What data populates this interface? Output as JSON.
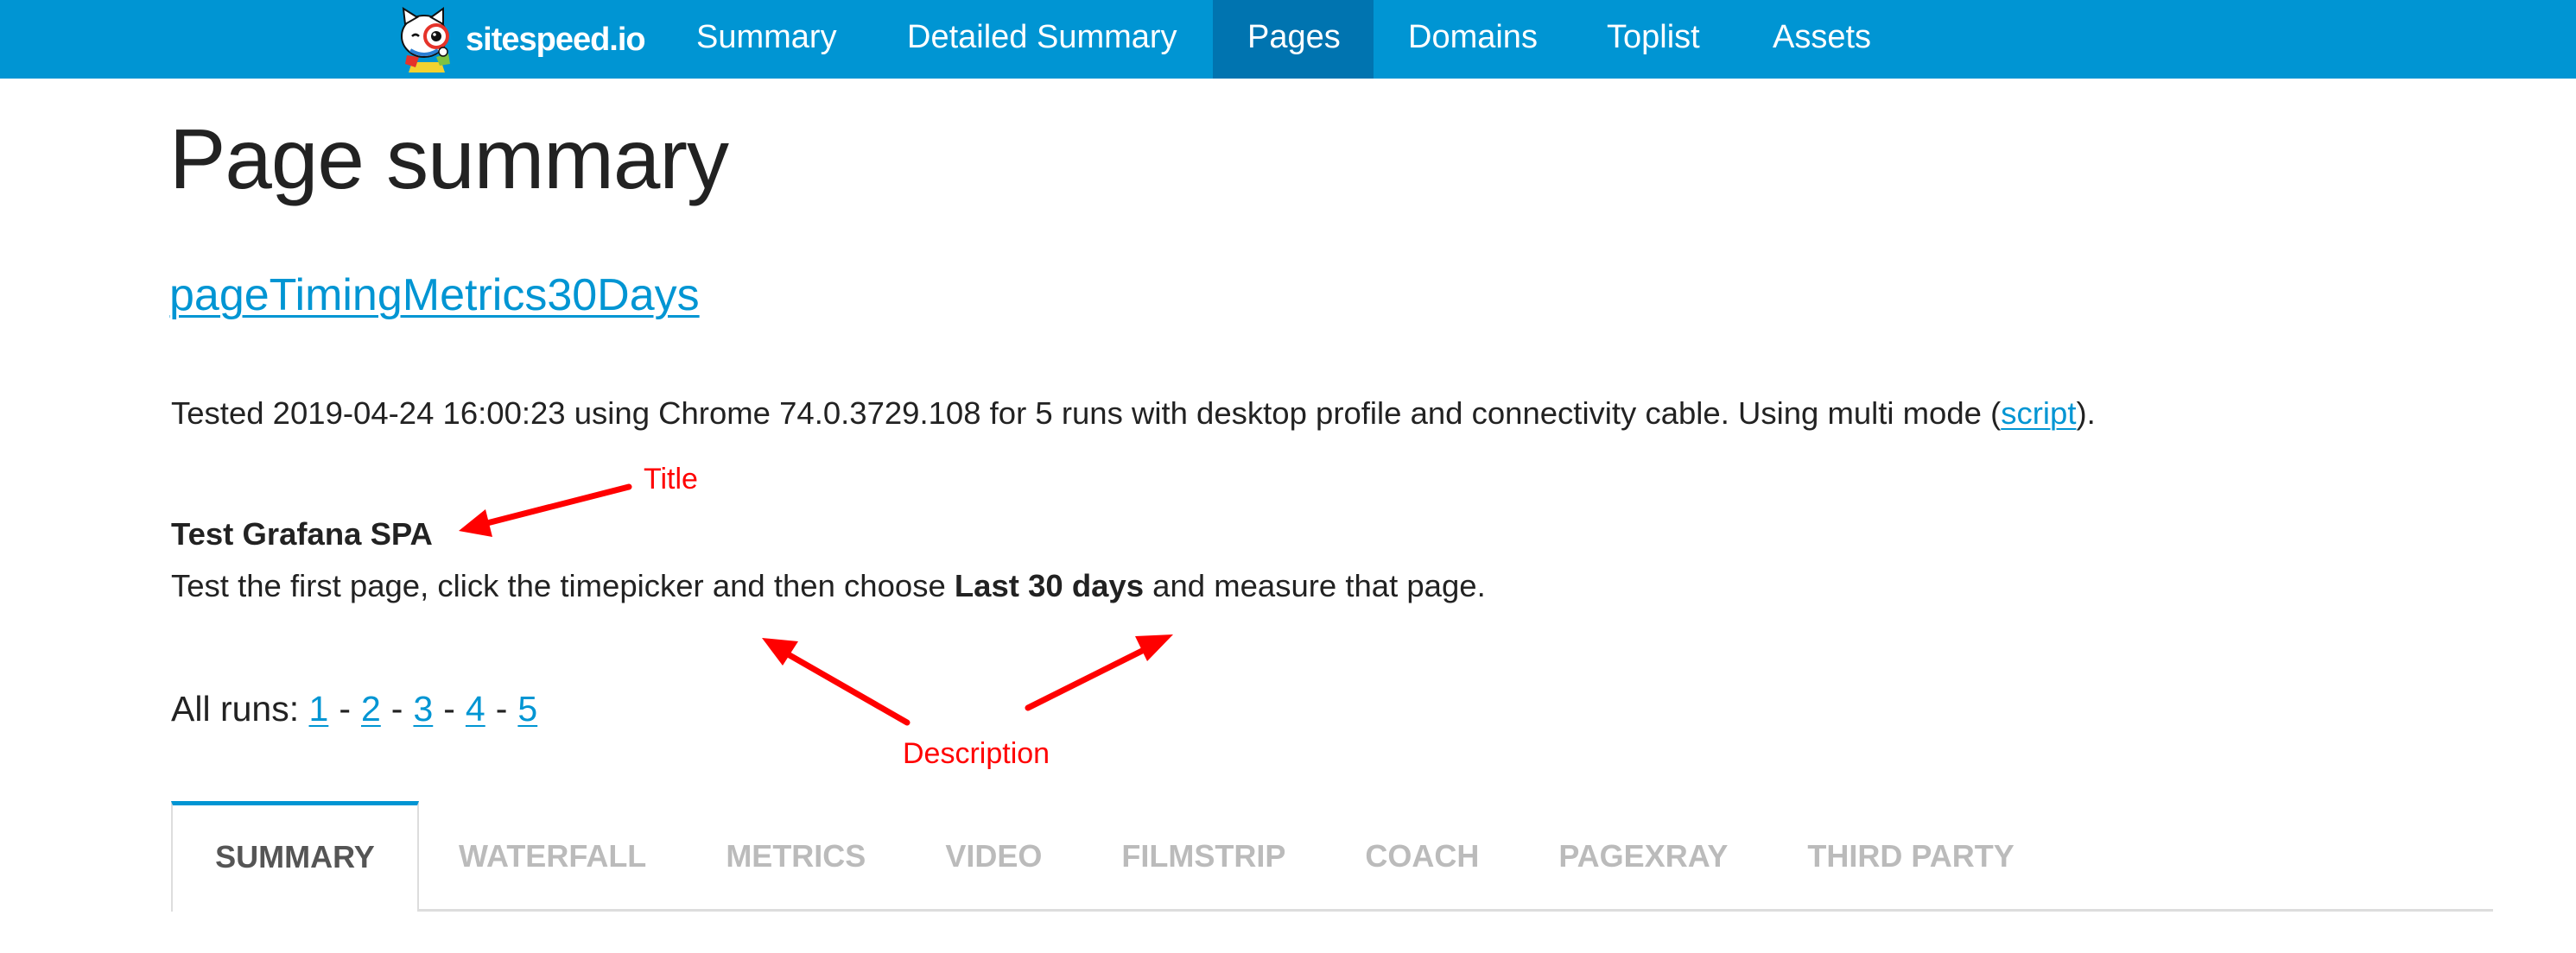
{
  "navbar": {
    "brand": "sitespeed.io",
    "logo_icon": "sitespeed-cat-logo-icon",
    "items": [
      {
        "label": "Summary",
        "active": false
      },
      {
        "label": "Detailed Summary",
        "active": false
      },
      {
        "label": "Pages",
        "active": true
      },
      {
        "label": "Domains",
        "active": false
      },
      {
        "label": "Toplist",
        "active": false
      },
      {
        "label": "Assets",
        "active": false
      }
    ],
    "colors": {
      "background": "#0095d3",
      "active": "#0074b0"
    }
  },
  "page": {
    "title": "Page summary",
    "page_link": "pageTimingMetrics30Days",
    "test_info": {
      "prefix": "Tested 2019-04-24 16:00:23 using Chrome 74.0.3729.108 for 5 runs with desktop profile and connectivity cable. Using multi mode (",
      "link": "script",
      "suffix": ")."
    },
    "test_title": "Test Grafana SPA",
    "description": {
      "before": "Test the first page, click the timepicker and then choose ",
      "bold": "Last 30 days",
      "after": " and measure that page."
    },
    "runs": {
      "label": "All runs:",
      "separator": "-",
      "items": [
        "1",
        "2",
        "3",
        "4",
        "5"
      ]
    }
  },
  "annotations": {
    "title_label": "Title",
    "description_label": "Description",
    "color": "#ff0000"
  },
  "tabs": [
    {
      "label": "SUMMARY",
      "active": true
    },
    {
      "label": "WATERFALL",
      "active": false
    },
    {
      "label": "METRICS",
      "active": false
    },
    {
      "label": "VIDEO",
      "active": false
    },
    {
      "label": "FILMSTRIP",
      "active": false
    },
    {
      "label": "COACH",
      "active": false
    },
    {
      "label": "PAGEXRAY",
      "active": false
    },
    {
      "label": "THIRD PARTY",
      "active": false
    }
  ]
}
